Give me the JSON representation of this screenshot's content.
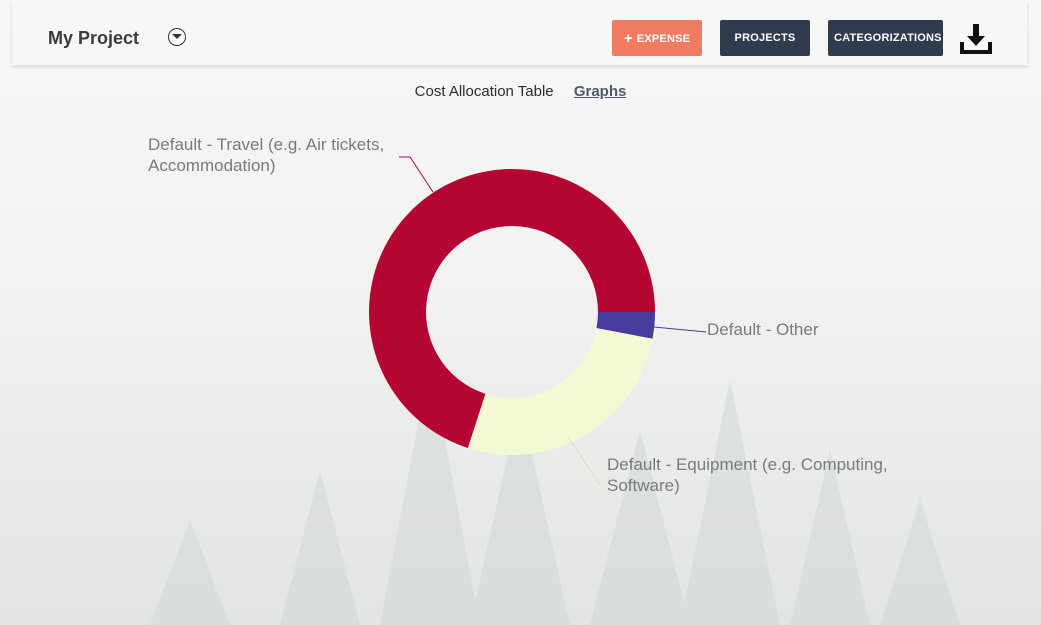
{
  "header": {
    "project_title": "My Project",
    "buttons": {
      "expense": "EXPENSE",
      "projects": "PROJECTS",
      "categorizations": "CATEGORIZATIONS"
    },
    "icons": {
      "project_toggle": "caret-down-circle-icon",
      "add": "plus-icon",
      "download": "download-icon"
    },
    "colors": {
      "expense_button": "#f07b63",
      "nav_button": "#303b4e"
    }
  },
  "tabs": [
    {
      "label": "Cost Allocation Table",
      "active": false
    },
    {
      "label": "Graphs",
      "active": true
    }
  ],
  "chart_data": {
    "type": "pie",
    "donut": true,
    "slices": [
      {
        "label": "Default - Other",
        "value": 3,
        "color": "#463c9e",
        "label_lines": [
          "Default - Other"
        ]
      },
      {
        "label": "Default - Equipment (e.g. Computing, Software)",
        "value": 27,
        "color": "#f5f8d5",
        "label_lines": [
          "Default - Equipment (e.g. Computing,",
          "Software)"
        ]
      },
      {
        "label": "Default - Travel (e.g. Air tickets, Accommodation)",
        "value": 70,
        "color": "#b50533",
        "label_lines": [
          "Default - Travel (e.g. Air tickets,",
          "Accommodation)"
        ]
      }
    ],
    "legend": "none"
  }
}
